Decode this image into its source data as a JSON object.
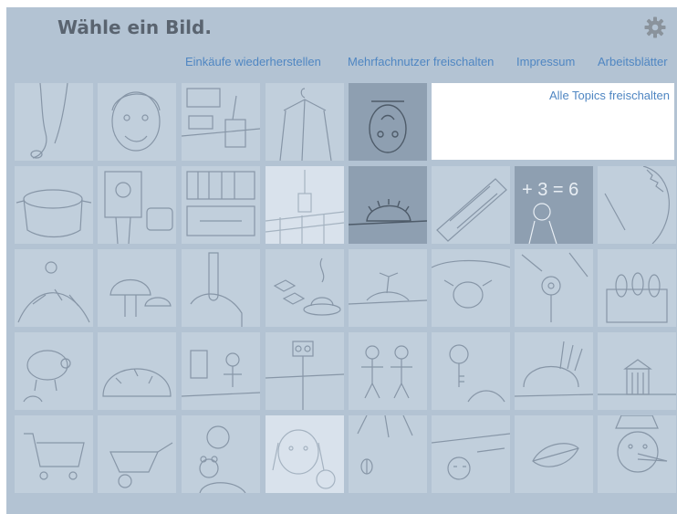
{
  "header": {
    "title": "Wähle ein Bild.",
    "settings_icon": "gear-icon"
  },
  "nav": {
    "restore_purchases": "Einkäufe wiederherstellen",
    "multiuser": "Mehrfachnutzer freischalten",
    "imprint": "Impressum",
    "worksheets": "Arbeitsblätter"
  },
  "unlock": {
    "label": "Alle Topics freischalten"
  },
  "grid": {
    "rows": [
      [
        "foot",
        "boy-face",
        "kitchen-cup",
        "jacket-hanger",
        "man-upside-down"
      ],
      [
        "pot",
        "man-portrait",
        "car-cabinet",
        "fence-candle",
        "hedgehog",
        "pencil-case",
        "boy-blackboard",
        "sawblade"
      ],
      [
        "trash-pile",
        "mushrooms",
        "hand-test-tube",
        "sugar-cubes-cup",
        "island",
        "cow",
        "pot-flower",
        "penguins-box"
      ],
      [
        "pig",
        "bush",
        "jars-kids",
        "traffic-light",
        "dancing-kids",
        "keys-hand",
        "snail-grass",
        "hut"
      ],
      [
        "shopping-cart",
        "wheelbarrow",
        "boy-teddy",
        "dog-cat",
        "butterfly",
        "sleeping-kid",
        "leaf",
        "snowman"
      ]
    ],
    "arithmetic_text": "+ 3 = 6"
  },
  "colors": {
    "background": "#b3c3d3",
    "tile": "#c1cfdc",
    "link": "#4f86c2",
    "title": "#5a6470"
  }
}
